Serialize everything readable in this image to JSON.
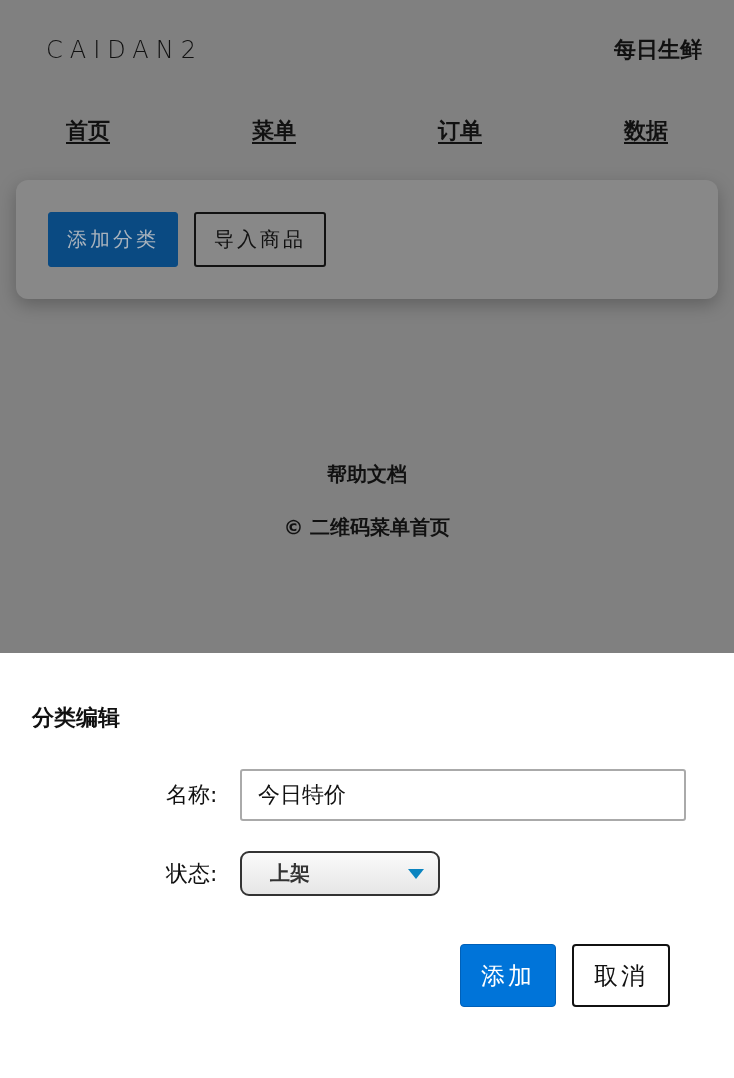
{
  "header": {
    "logo": "CAIDAN2",
    "shop_name": "每日生鲜"
  },
  "nav": [
    {
      "label": "首页"
    },
    {
      "label": "菜单"
    },
    {
      "label": "订单"
    },
    {
      "label": "数据"
    }
  ],
  "toolbar": {
    "buttons": [
      {
        "label": "添加分类",
        "kind": "primary"
      },
      {
        "label": "导入商品",
        "kind": "outline"
      }
    ]
  },
  "footer": {
    "help_link": "帮助文档",
    "copyright": "© 二维码菜单首页"
  },
  "dialog": {
    "title": "分类编辑",
    "fields": [
      {
        "kind": "text",
        "label": "名称:",
        "value": "今日特价"
      },
      {
        "kind": "select",
        "label": "状态:",
        "value": "上架"
      }
    ],
    "buttons": [
      {
        "label": "添加",
        "kind": "primary"
      },
      {
        "label": "取消",
        "kind": "outline"
      }
    ]
  }
}
